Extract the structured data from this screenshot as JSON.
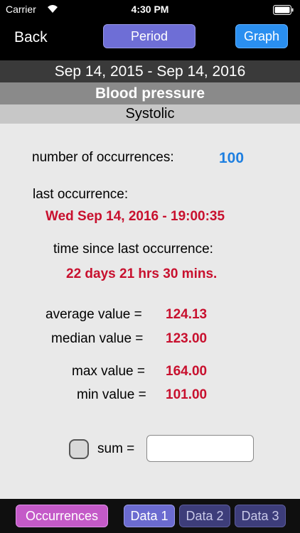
{
  "status_bar": {
    "carrier": "Carrier",
    "time": "4:30 PM"
  },
  "nav": {
    "back_label": "Back",
    "period_label": "Period",
    "graph_label": "Graph"
  },
  "date_range": "Sep 14, 2015 - Sep 14, 2016",
  "title": "Blood pressure",
  "subtitle": "Systolic",
  "stats": {
    "occurrences_label": "number of occurrences:",
    "occurrences_value": "100",
    "last_occurrence_label": "last occurrence:",
    "last_occurrence_value": "Wed  Sep 14, 2016 - 19:00:35",
    "time_since_label": "time since last occurrence:",
    "time_since_value": "22 days 21 hrs 30 mins.",
    "average_label": "average value =",
    "average_value": "124.13",
    "median_label": "median value =",
    "median_value": "123.00",
    "max_label": "max value =",
    "max_value": "164.00",
    "min_label": "min value =",
    "min_value": "101.00",
    "sum_label": "sum =",
    "sum_value": ""
  },
  "bottom_tabs": {
    "occurrences": "Occurrences",
    "data1": "Data 1",
    "data2": "Data 2",
    "data3": "Data 3"
  },
  "colors": {
    "accent_blue": "#1e7fe0",
    "value_red": "#c8102e",
    "button_purple": "#6b6bd0",
    "tab_purple": "#c040c0"
  }
}
